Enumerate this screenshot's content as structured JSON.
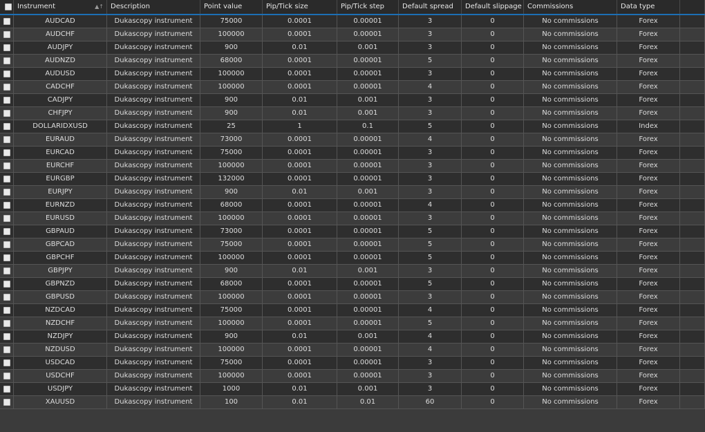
{
  "columns": [
    "Instrument",
    "Description",
    "Point value",
    "Pip/Tick size",
    "Pip/Tick step",
    "Default spread",
    "Default slippage",
    "Commissions",
    "Data type"
  ],
  "sort_icon": "▲↑",
  "rows": [
    [
      "AUDCAD",
      "Dukascopy instrument",
      "75000",
      "0.0001",
      "0.00001",
      "3",
      "0",
      "No commissions",
      "Forex"
    ],
    [
      "AUDCHF",
      "Dukascopy instrument",
      "100000",
      "0.0001",
      "0.00001",
      "3",
      "0",
      "No commissions",
      "Forex"
    ],
    [
      "AUDJPY",
      "Dukascopy instrument",
      "900",
      "0.01",
      "0.001",
      "3",
      "0",
      "No commissions",
      "Forex"
    ],
    [
      "AUDNZD",
      "Dukascopy instrument",
      "68000",
      "0.0001",
      "0.00001",
      "5",
      "0",
      "No commissions",
      "Forex"
    ],
    [
      "AUDUSD",
      "Dukascopy instrument",
      "100000",
      "0.0001",
      "0.00001",
      "3",
      "0",
      "No commissions",
      "Forex"
    ],
    [
      "CADCHF",
      "Dukascopy instrument",
      "100000",
      "0.0001",
      "0.00001",
      "4",
      "0",
      "No commissions",
      "Forex"
    ],
    [
      "CADJPY",
      "Dukascopy instrument",
      "900",
      "0.01",
      "0.001",
      "3",
      "0",
      "No commissions",
      "Forex"
    ],
    [
      "CHFJPY",
      "Dukascopy instrument",
      "900",
      "0.01",
      "0.001",
      "3",
      "0",
      "No commissions",
      "Forex"
    ],
    [
      "DOLLARIDXUSD",
      "Dukascopy instrument",
      "25",
      "1",
      "0.1",
      "5",
      "0",
      "No commissions",
      "Index"
    ],
    [
      "EURAUD",
      "Dukascopy instrument",
      "73000",
      "0.0001",
      "0.00001",
      "4",
      "0",
      "No commissions",
      "Forex"
    ],
    [
      "EURCAD",
      "Dukascopy instrument",
      "75000",
      "0.0001",
      "0.00001",
      "3",
      "0",
      "No commissions",
      "Forex"
    ],
    [
      "EURCHF",
      "Dukascopy instrument",
      "100000",
      "0.0001",
      "0.00001",
      "3",
      "0",
      "No commissions",
      "Forex"
    ],
    [
      "EURGBP",
      "Dukascopy instrument",
      "132000",
      "0.0001",
      "0.00001",
      "3",
      "0",
      "No commissions",
      "Forex"
    ],
    [
      "EURJPY",
      "Dukascopy instrument",
      "900",
      "0.01",
      "0.001",
      "3",
      "0",
      "No commissions",
      "Forex"
    ],
    [
      "EURNZD",
      "Dukascopy instrument",
      "68000",
      "0.0001",
      "0.00001",
      "4",
      "0",
      "No commissions",
      "Forex"
    ],
    [
      "EURUSD",
      "Dukascopy instrument",
      "100000",
      "0.0001",
      "0.00001",
      "3",
      "0",
      "No commissions",
      "Forex"
    ],
    [
      "GBPAUD",
      "Dukascopy instrument",
      "73000",
      "0.0001",
      "0.00001",
      "5",
      "0",
      "No commissions",
      "Forex"
    ],
    [
      "GBPCAD",
      "Dukascopy instrument",
      "75000",
      "0.0001",
      "0.00001",
      "5",
      "0",
      "No commissions",
      "Forex"
    ],
    [
      "GBPCHF",
      "Dukascopy instrument",
      "100000",
      "0.0001",
      "0.00001",
      "5",
      "0",
      "No commissions",
      "Forex"
    ],
    [
      "GBPJPY",
      "Dukascopy instrument",
      "900",
      "0.01",
      "0.001",
      "3",
      "0",
      "No commissions",
      "Forex"
    ],
    [
      "GBPNZD",
      "Dukascopy instrument",
      "68000",
      "0.0001",
      "0.00001",
      "5",
      "0",
      "No commissions",
      "Forex"
    ],
    [
      "GBPUSD",
      "Dukascopy instrument",
      "100000",
      "0.0001",
      "0.00001",
      "3",
      "0",
      "No commissions",
      "Forex"
    ],
    [
      "NZDCAD",
      "Dukascopy instrument",
      "75000",
      "0.0001",
      "0.00001",
      "4",
      "0",
      "No commissions",
      "Forex"
    ],
    [
      "NZDCHF",
      "Dukascopy instrument",
      "100000",
      "0.0001",
      "0.00001",
      "5",
      "0",
      "No commissions",
      "Forex"
    ],
    [
      "NZDJPY",
      "Dukascopy instrument",
      "900",
      "0.01",
      "0.001",
      "4",
      "0",
      "No commissions",
      "Forex"
    ],
    [
      "NZDUSD",
      "Dukascopy instrument",
      "100000",
      "0.0001",
      "0.00001",
      "4",
      "0",
      "No commissions",
      "Forex"
    ],
    [
      "USDCAD",
      "Dukascopy instrument",
      "75000",
      "0.0001",
      "0.00001",
      "3",
      "0",
      "No commissions",
      "Forex"
    ],
    [
      "USDCHF",
      "Dukascopy instrument",
      "100000",
      "0.0001",
      "0.00001",
      "3",
      "0",
      "No commissions",
      "Forex"
    ],
    [
      "USDJPY",
      "Dukascopy instrument",
      "1000",
      "0.01",
      "0.001",
      "3",
      "0",
      "No commissions",
      "Forex"
    ],
    [
      "XAUUSD",
      "Dukascopy instrument",
      "100",
      "0.01",
      "0.01",
      "60",
      "0",
      "No commissions",
      "Forex"
    ]
  ]
}
